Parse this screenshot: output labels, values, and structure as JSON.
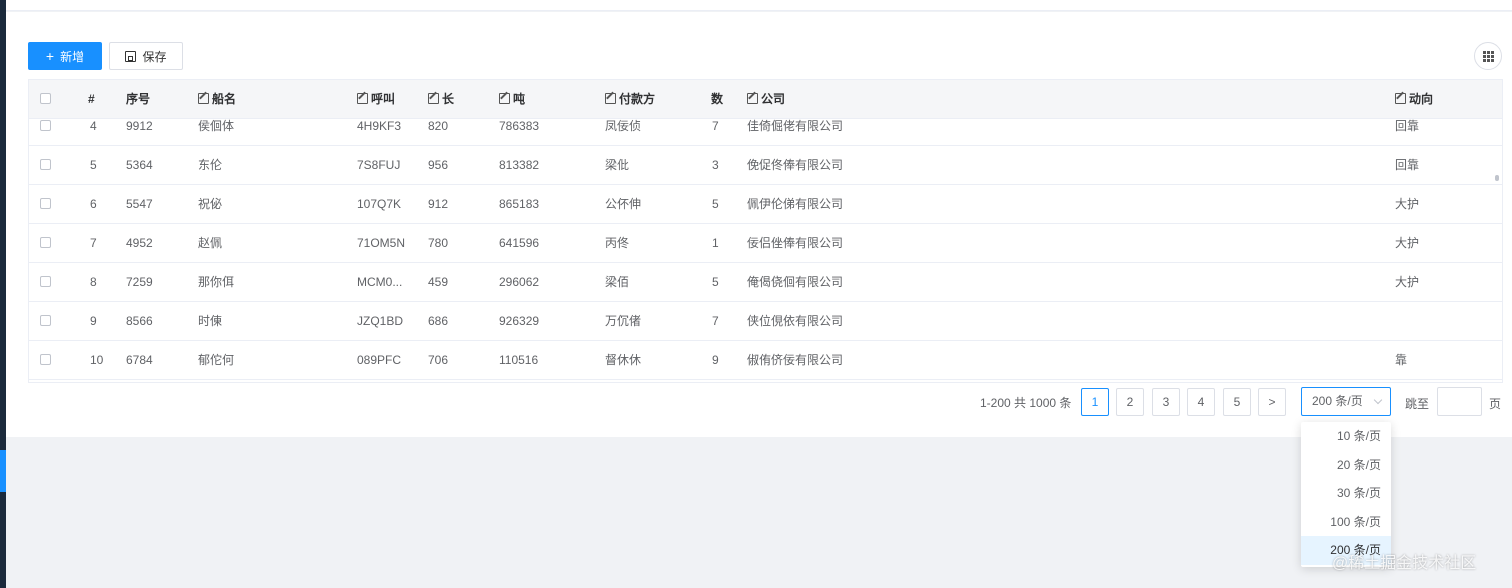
{
  "toolbar": {
    "add_label": "新增",
    "save_label": "保存"
  },
  "table": {
    "columns": {
      "index": "#",
      "seq": "序号",
      "ship": "船名",
      "call": "呼叫",
      "length": "长",
      "ton": "吨",
      "payer": "付款方",
      "count": "数",
      "company": "公司",
      "direction": "动向"
    },
    "rows": [
      {
        "index": "4",
        "seq": "9912",
        "ship": "侯佪体",
        "call": "4H9KF3",
        "length": "820",
        "ton": "786383",
        "payer": "凤佞侦",
        "count": "7",
        "company": "佳倚倔佬有限公司",
        "direction": "回靠"
      },
      {
        "index": "5",
        "seq": "5364",
        "ship": "东伦",
        "call": "7S8FUJ",
        "length": "956",
        "ton": "813382",
        "payer": "梁仳",
        "count": "3",
        "company": "俛促佟俸有限公司",
        "direction": "回靠"
      },
      {
        "index": "6",
        "seq": "5547",
        "ship": "祝佖",
        "call": "107Q7K",
        "length": "912",
        "ton": "865183",
        "payer": "公伓伸",
        "count": "5",
        "company": "佩伊伦俤有限公司",
        "direction": "大护"
      },
      {
        "index": "7",
        "seq": "4952",
        "ship": "赵佩",
        "call": "71OM5N",
        "length": "780",
        "ton": "641596",
        "payer": "丙佟",
        "count": "1",
        "company": "佞侣侳俸有限公司",
        "direction": "大护"
      },
      {
        "index": "8",
        "seq": "7259",
        "ship": "那你佴",
        "call": "MCM0...",
        "length": "459",
        "ton": "296062",
        "payer": "梁佰",
        "count": "5",
        "company": "俺偈侥佪有限公司",
        "direction": "大护"
      },
      {
        "index": "9",
        "seq": "8566",
        "ship": "时倲",
        "call": "JZQ1BD",
        "length": "686",
        "ton": "926329",
        "payer": "万伔偖",
        "count": "7",
        "company": "侠位俔依有限公司",
        "direction": ""
      },
      {
        "index": "10",
        "seq": "6784",
        "ship": "郁佗何",
        "call": "089PFC",
        "length": "706",
        "ton": "110516",
        "payer": "督休休",
        "count": "9",
        "company": "俶侑侪佞有限公司",
        "direction": "靠"
      }
    ]
  },
  "pagination": {
    "total_text": "1-200 共 1000 条",
    "pages": [
      "1",
      "2",
      "3",
      "4",
      "5"
    ],
    "current_page": "1",
    "next": ">",
    "page_size": "200 条/页",
    "page_size_options": [
      "10 条/页",
      "20 条/页",
      "30 条/页",
      "100 条/页",
      "200 条/页"
    ],
    "jump_label": "跳至",
    "jump_suffix": "页"
  },
  "watermark": "@稀土掘金技术社区",
  "colors": {
    "primary": "#1890ff",
    "sidebar": "#1b2a3c",
    "header_bg": "#f5f6f8",
    "page_bg": "#f0f2f5"
  },
  "icons": {
    "add": "plus-icon",
    "save": "save-icon",
    "edit": "edit-icon",
    "column_settings": "grid-icon",
    "dropdown": "chevron-down-icon"
  }
}
